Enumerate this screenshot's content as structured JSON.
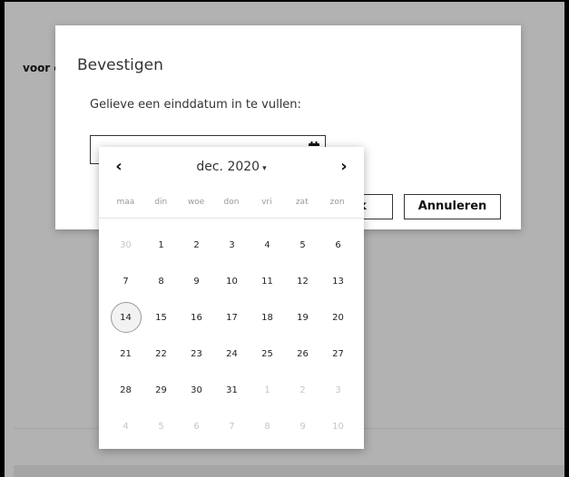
{
  "background": {
    "partial_text": "voor c"
  },
  "modal": {
    "title": "Bevestigen",
    "prompt": "Gelieve een einddatum in te vullen:",
    "date_value": "",
    "ok_label": "Ok",
    "cancel_label": "Annuleren"
  },
  "datepicker": {
    "prev_label": "‹",
    "next_label": "›",
    "month_label": "dec. 2020",
    "caret": "▾",
    "weekdays": [
      "maa",
      "din",
      "woe",
      "don",
      "vri",
      "zat",
      "zon"
    ],
    "weeks": [
      [
        "30",
        "1",
        "2",
        "3",
        "4",
        "5",
        "6"
      ],
      [
        "7",
        "8",
        "9",
        "10",
        "11",
        "12",
        "13"
      ],
      [
        "14",
        "15",
        "16",
        "17",
        "18",
        "19",
        "20"
      ],
      [
        "21",
        "22",
        "23",
        "24",
        "25",
        "26",
        "27"
      ],
      [
        "28",
        "29",
        "30",
        "31",
        "1",
        "2",
        "3"
      ],
      [
        "4",
        "5",
        "6",
        "7",
        "8",
        "9",
        "10"
      ]
    ],
    "today": "14",
    "icons": {
      "calendar": "calendar-icon",
      "cursor": "mouse-cursor-icon"
    }
  },
  "colors": {
    "overlay": "#b2b2b2",
    "today_ring": "#9a9a9a",
    "muted_day": "#c6c6c6"
  }
}
